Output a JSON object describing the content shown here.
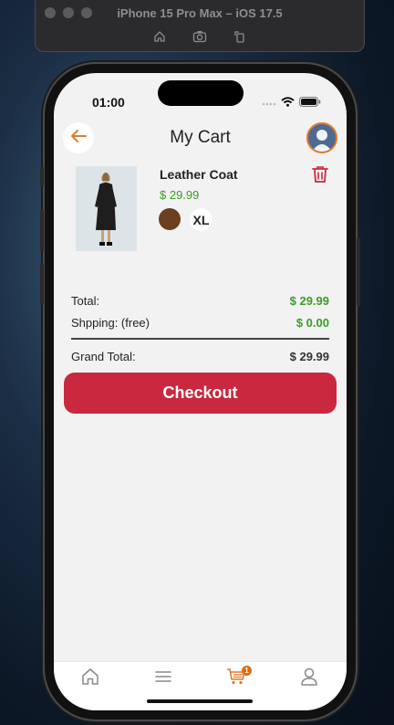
{
  "simulator": {
    "title": "iPhone 15 Pro Max – iOS 17.5"
  },
  "status_bar": {
    "time": "01:00"
  },
  "header": {
    "title": "My Cart"
  },
  "cart_items": [
    {
      "name": "Leather Coat",
      "price": "$ 29.99",
      "color": "#6b3f1f",
      "size": "XL"
    }
  ],
  "summary": {
    "total_label": "Total:",
    "total_value": "$ 29.99",
    "shipping_label": "Shpping: (free)",
    "shipping_value": "$ 0.00",
    "grand_label": "Grand Total:",
    "grand_value": "$ 29.99"
  },
  "checkout_label": "Checkout",
  "tabbar": {
    "cart_badge": "1",
    "active_tab": "cart"
  },
  "colors": {
    "accent": "#e07a2a",
    "primary_button": "#c9283e",
    "price_green": "#3a9d23"
  }
}
